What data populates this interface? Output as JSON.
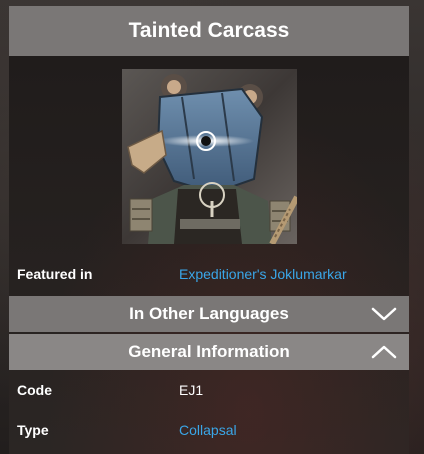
{
  "infobox": {
    "title": "Tainted Carcass",
    "portrait_alt": "tainted-carcass-portrait",
    "featured": {
      "label": "Featured in",
      "value": "Expeditioner's Joklumarkar"
    },
    "sections": [
      {
        "title": "In Other Languages",
        "state": "collapsed",
        "icon": "chevron-down-icon"
      },
      {
        "title": "General Information",
        "state": "expanded",
        "icon": "chevron-up-icon"
      }
    ],
    "general": [
      {
        "label": "Code",
        "value": "EJ1",
        "is_link": false
      },
      {
        "label": "Type",
        "value": "Collapsal",
        "is_link": true
      }
    ]
  },
  "colors": {
    "header_bg": "#7a7776",
    "link": "#3aa6e8",
    "panel_bg": "#1f1b1a"
  }
}
